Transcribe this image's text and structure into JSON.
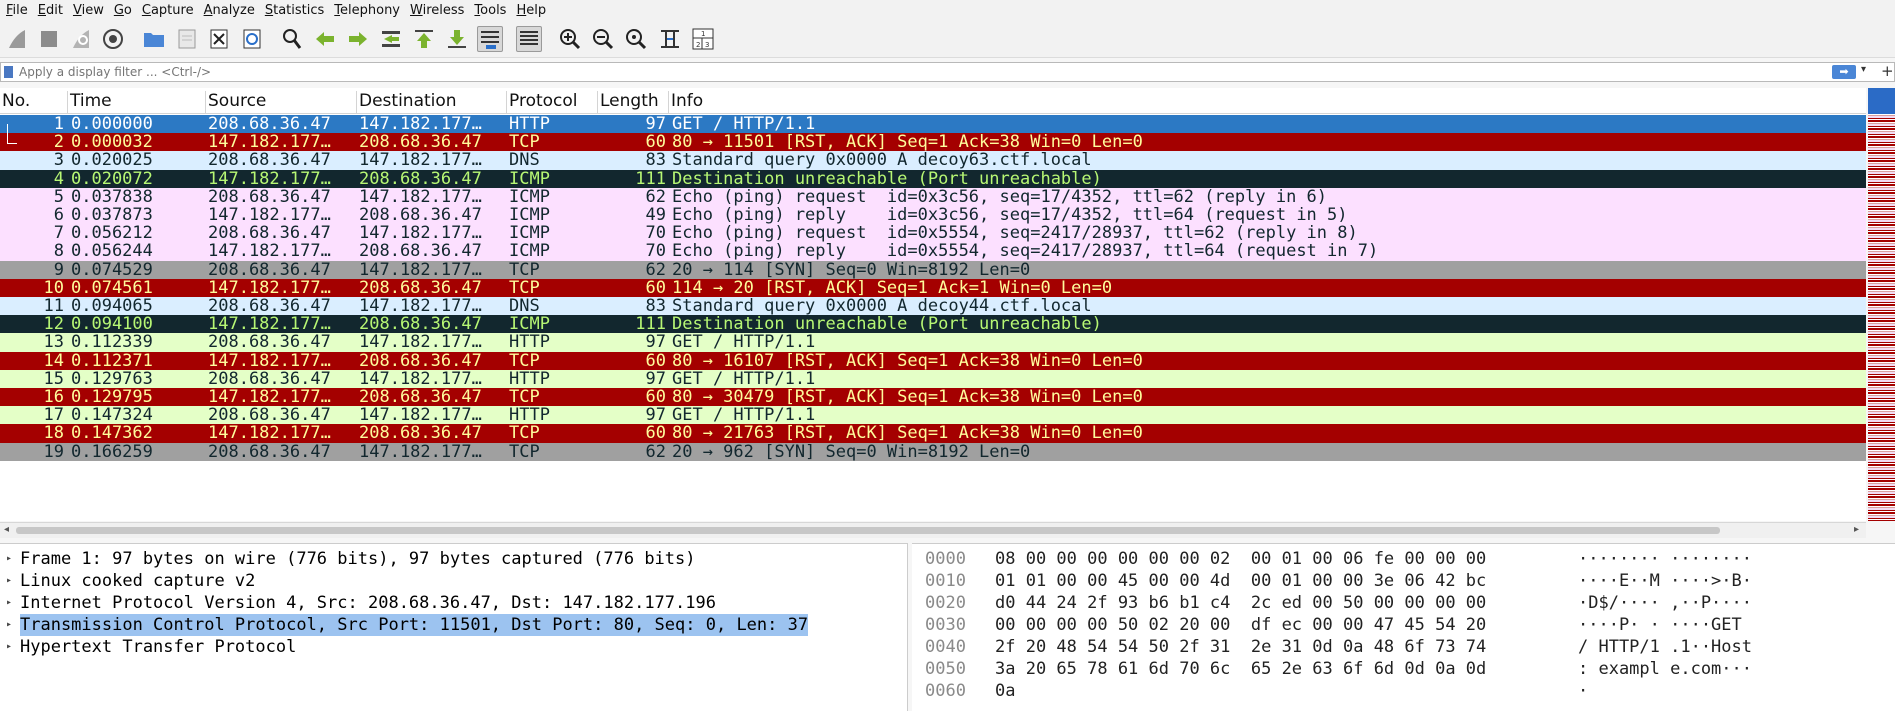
{
  "menu": [
    "File",
    "Edit",
    "View",
    "Go",
    "Capture",
    "Analyze",
    "Statistics",
    "Telephony",
    "Wireless",
    "Tools",
    "Help"
  ],
  "toolbar_icons": [
    "shark-fin-start-icon",
    "stop-capture-icon",
    "restart-capture-icon",
    "capture-options-icon",
    "open-file-icon",
    "save-file-icon",
    "close-file-icon",
    "reload-file-icon",
    "find-packet-icon",
    "go-back-icon",
    "go-forward-icon",
    "go-to-packet-icon",
    "first-packet-icon",
    "last-packet-icon",
    "autoscroll-icon",
    "colorize-icon",
    "zoom-in-icon",
    "zoom-out-icon",
    "zoom-normal-icon",
    "resize-columns-icon",
    "layout-icon"
  ],
  "filter": {
    "placeholder": "Apply a display filter ... <Ctrl-/>",
    "apply_icon": "➡",
    "dropdown_icon": "▾",
    "add_icon": "+"
  },
  "columns": [
    "No.",
    "Time",
    "Source",
    "Destination",
    "Protocol",
    "Length",
    "Info"
  ],
  "colors": {
    "selected_bg": "#2c79c4",
    "tcp_rst_bg": "#a40000",
    "tcp_rst_fg": "#fffc9c",
    "dns_bg": "#daeeff",
    "icmp_err_bg": "#12272e",
    "icmp_err_fg": "#b7f774",
    "icmp_bg": "#fce0ff",
    "tcp_syn_bg": "#a0a0a0",
    "http_bg": "#e4ffc7"
  },
  "packets": [
    {
      "no": "1",
      "time": "0.000000",
      "src": "208.68.36.47",
      "dst": "147.182.177…",
      "proto": "HTTP",
      "len": "97",
      "info": "GET / HTTP/1.1",
      "style": "selected"
    },
    {
      "no": "2",
      "time": "0.000032",
      "src": "147.182.177…",
      "dst": "208.68.36.47",
      "proto": "TCP",
      "len": "60",
      "info": "80 → 11501 [RST, ACK] Seq=1 Ack=38 Win=0 Len=0",
      "style": "rst"
    },
    {
      "no": "3",
      "time": "0.020025",
      "src": "208.68.36.47",
      "dst": "147.182.177…",
      "proto": "DNS",
      "len": "83",
      "info": "Standard query 0x0000 A decoy63.ctf.local",
      "style": "dns"
    },
    {
      "no": "4",
      "time": "0.020072",
      "src": "147.182.177…",
      "dst": "208.68.36.47",
      "proto": "ICMP",
      "len": "111",
      "info": "Destination unreachable (Port unreachable)",
      "style": "icmperr"
    },
    {
      "no": "5",
      "time": "0.037838",
      "src": "208.68.36.47",
      "dst": "147.182.177…",
      "proto": "ICMP",
      "len": "62",
      "info": "Echo (ping) request  id=0x3c56, seq=17/4352, ttl=62 (reply in 6)",
      "style": "icmp"
    },
    {
      "no": "6",
      "time": "0.037873",
      "src": "147.182.177…",
      "dst": "208.68.36.47",
      "proto": "ICMP",
      "len": "49",
      "info": "Echo (ping) reply    id=0x3c56, seq=17/4352, ttl=64 (request in 5)",
      "style": "icmp"
    },
    {
      "no": "7",
      "time": "0.056212",
      "src": "208.68.36.47",
      "dst": "147.182.177…",
      "proto": "ICMP",
      "len": "70",
      "info": "Echo (ping) request  id=0x5554, seq=2417/28937, ttl=62 (reply in 8)",
      "style": "icmp"
    },
    {
      "no": "8",
      "time": "0.056244",
      "src": "147.182.177…",
      "dst": "208.68.36.47",
      "proto": "ICMP",
      "len": "70",
      "info": "Echo (ping) reply    id=0x5554, seq=2417/28937, ttl=64 (request in 7)",
      "style": "icmp"
    },
    {
      "no": "9",
      "time": "0.074529",
      "src": "208.68.36.47",
      "dst": "147.182.177…",
      "proto": "TCP",
      "len": "62",
      "info": "20 → 114 [SYN] Seq=0 Win=8192 Len=0",
      "style": "syn"
    },
    {
      "no": "10",
      "time": "0.074561",
      "src": "147.182.177…",
      "dst": "208.68.36.47",
      "proto": "TCP",
      "len": "60",
      "info": "114 → 20 [RST, ACK] Seq=1 Ack=1 Win=0 Len=0",
      "style": "rst"
    },
    {
      "no": "11",
      "time": "0.094065",
      "src": "208.68.36.47",
      "dst": "147.182.177…",
      "proto": "DNS",
      "len": "83",
      "info": "Standard query 0x0000 A decoy44.ctf.local",
      "style": "dns"
    },
    {
      "no": "12",
      "time": "0.094100",
      "src": "147.182.177…",
      "dst": "208.68.36.47",
      "proto": "ICMP",
      "len": "111",
      "info": "Destination unreachable (Port unreachable)",
      "style": "icmperr"
    },
    {
      "no": "13",
      "time": "0.112339",
      "src": "208.68.36.47",
      "dst": "147.182.177…",
      "proto": "HTTP",
      "len": "97",
      "info": "GET / HTTP/1.1",
      "style": "http"
    },
    {
      "no": "14",
      "time": "0.112371",
      "src": "147.182.177…",
      "dst": "208.68.36.47",
      "proto": "TCP",
      "len": "60",
      "info": "80 → 16107 [RST, ACK] Seq=1 Ack=38 Win=0 Len=0",
      "style": "rst"
    },
    {
      "no": "15",
      "time": "0.129763",
      "src": "208.68.36.47",
      "dst": "147.182.177…",
      "proto": "HTTP",
      "len": "97",
      "info": "GET / HTTP/1.1",
      "style": "http"
    },
    {
      "no": "16",
      "time": "0.129795",
      "src": "147.182.177…",
      "dst": "208.68.36.47",
      "proto": "TCP",
      "len": "60",
      "info": "80 → 30479 [RST, ACK] Seq=1 Ack=38 Win=0 Len=0",
      "style": "rst"
    },
    {
      "no": "17",
      "time": "0.147324",
      "src": "208.68.36.47",
      "dst": "147.182.177…",
      "proto": "HTTP",
      "len": "97",
      "info": "GET / HTTP/1.1",
      "style": "http"
    },
    {
      "no": "18",
      "time": "0.147362",
      "src": "147.182.177…",
      "dst": "208.68.36.47",
      "proto": "TCP",
      "len": "60",
      "info": "80 → 21763 [RST, ACK] Seq=1 Ack=38 Win=0 Len=0",
      "style": "rst"
    },
    {
      "no": "19",
      "time": "0.166259",
      "src": "208.68.36.47",
      "dst": "147.182.177…",
      "proto": "TCP",
      "len": "62",
      "info": "20 → 962 [SYN] Seq=0 Win=8192 Len=0",
      "style": "syn"
    }
  ],
  "details": [
    {
      "text": "Frame 1: 97 bytes on wire (776 bits), 97 bytes captured (776 bits)",
      "selected": false
    },
    {
      "text": "Linux cooked capture v2",
      "selected": false
    },
    {
      "text": "Internet Protocol Version 4, Src: 208.68.36.47, Dst: 147.182.177.196",
      "selected": false
    },
    {
      "text": "Transmission Control Protocol, Src Port: 11501, Dst Port: 80, Seq: 0, Len: 37",
      "selected": true
    },
    {
      "text": "Hypertext Transfer Protocol",
      "selected": false
    }
  ],
  "bytes": [
    {
      "offset": "0000",
      "hex": "08 00 00 00 00 00 00 02  00 01 00 06 fe 00 00 00",
      "ascii": "········ ········"
    },
    {
      "offset": "0010",
      "hex": "01 01 00 00 45 00 00 4d  00 01 00 00 3e 06 42 bc",
      "ascii": "····E··M ····>·B·"
    },
    {
      "offset": "0020",
      "hex": "d0 44 24 2f 93 b6 b1 c4  2c ed 00 50 00 00 00 00",
      "ascii": "·D$/···· ,··P····"
    },
    {
      "offset": "0030",
      "hex": "00 00 00 00 50 02 20 00  df ec 00 00 47 45 54 20",
      "ascii": "····P· · ····GET "
    },
    {
      "offset": "0040",
      "hex": "2f 20 48 54 54 50 2f 31  2e 31 0d 0a 48 6f 73 74",
      "ascii": "/ HTTP/1 .1··Host"
    },
    {
      "offset": "0050",
      "hex": "3a 20 65 78 61 6d 70 6c  65 2e 63 6f 6d 0d 0a 0d",
      "ascii": ": exampl e.com···"
    },
    {
      "offset": "0060",
      "hex": "0a",
      "ascii": "·"
    }
  ]
}
